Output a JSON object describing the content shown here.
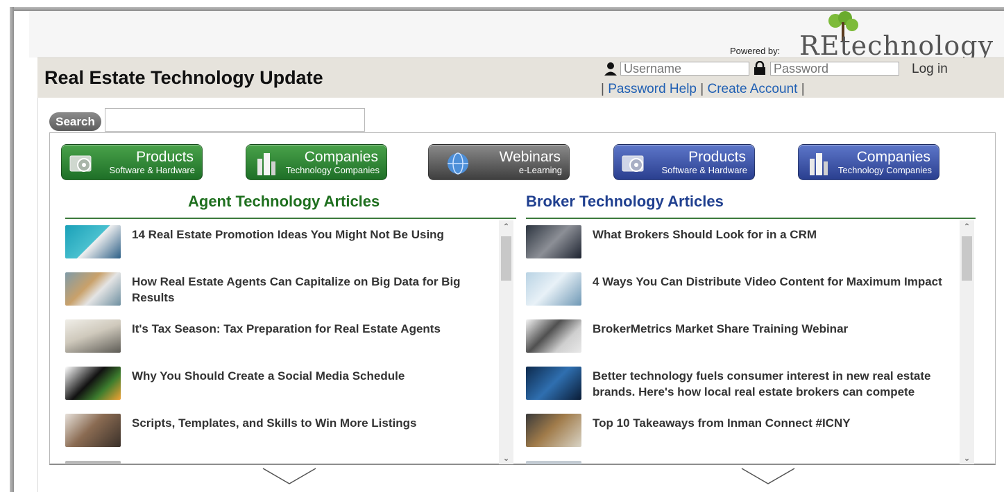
{
  "branding": {
    "powered_by": "Powered by:",
    "logo_text": "REtechnology"
  },
  "header": {
    "site_title": "Real Estate Technology Update",
    "username_placeholder": "Username",
    "password_placeholder": "Password",
    "login_label": "Log in",
    "links": {
      "separator": "|",
      "password_help": "Password Help",
      "create_account": "Create Account"
    }
  },
  "search": {
    "button_label": "Search",
    "value": ""
  },
  "nav_buttons": [
    {
      "title": "Products",
      "subtitle": "Software & Hardware",
      "color": "green",
      "icon": "gear-icon"
    },
    {
      "title": "Companies",
      "subtitle": "Technology Companies",
      "color": "green",
      "icon": "building-icon"
    },
    {
      "title": "Webinars",
      "subtitle": "e-Learning",
      "color": "gray",
      "icon": "globe-icon"
    },
    {
      "title": "Products",
      "subtitle": "Software & Hardware",
      "color": "blue",
      "icon": "gear-icon"
    },
    {
      "title": "Companies",
      "subtitle": "Technology Companies",
      "color": "blue",
      "icon": "building-icon"
    }
  ],
  "agent": {
    "heading": "Agent Technology Articles",
    "heading_color": "#1e6f1e",
    "articles": [
      "14 Real Estate Promotion Ideas You Might Not Be Using",
      "How Real Estate Agents Can Capitalize on Big Data for Big Results",
      "It's Tax Season: Tax Preparation for Real Estate Agents",
      "Why You Should Create a Social Media Schedule",
      "Scripts, Templates, and Skills to Win More Listings"
    ]
  },
  "broker": {
    "heading": "Broker Technology Articles",
    "heading_color": "#1f3f8f",
    "articles": [
      "What Brokers Should Look for in a CRM",
      "4 Ways You Can Distribute Video Content for Maximum Impact",
      "BrokerMetrics Market Share Training Webinar",
      "Better technology fuels consumer interest in new real estate brands. Here's how local real estate brokers can compete",
      "Top 10 Takeaways from Inman Connect #ICNY"
    ]
  }
}
